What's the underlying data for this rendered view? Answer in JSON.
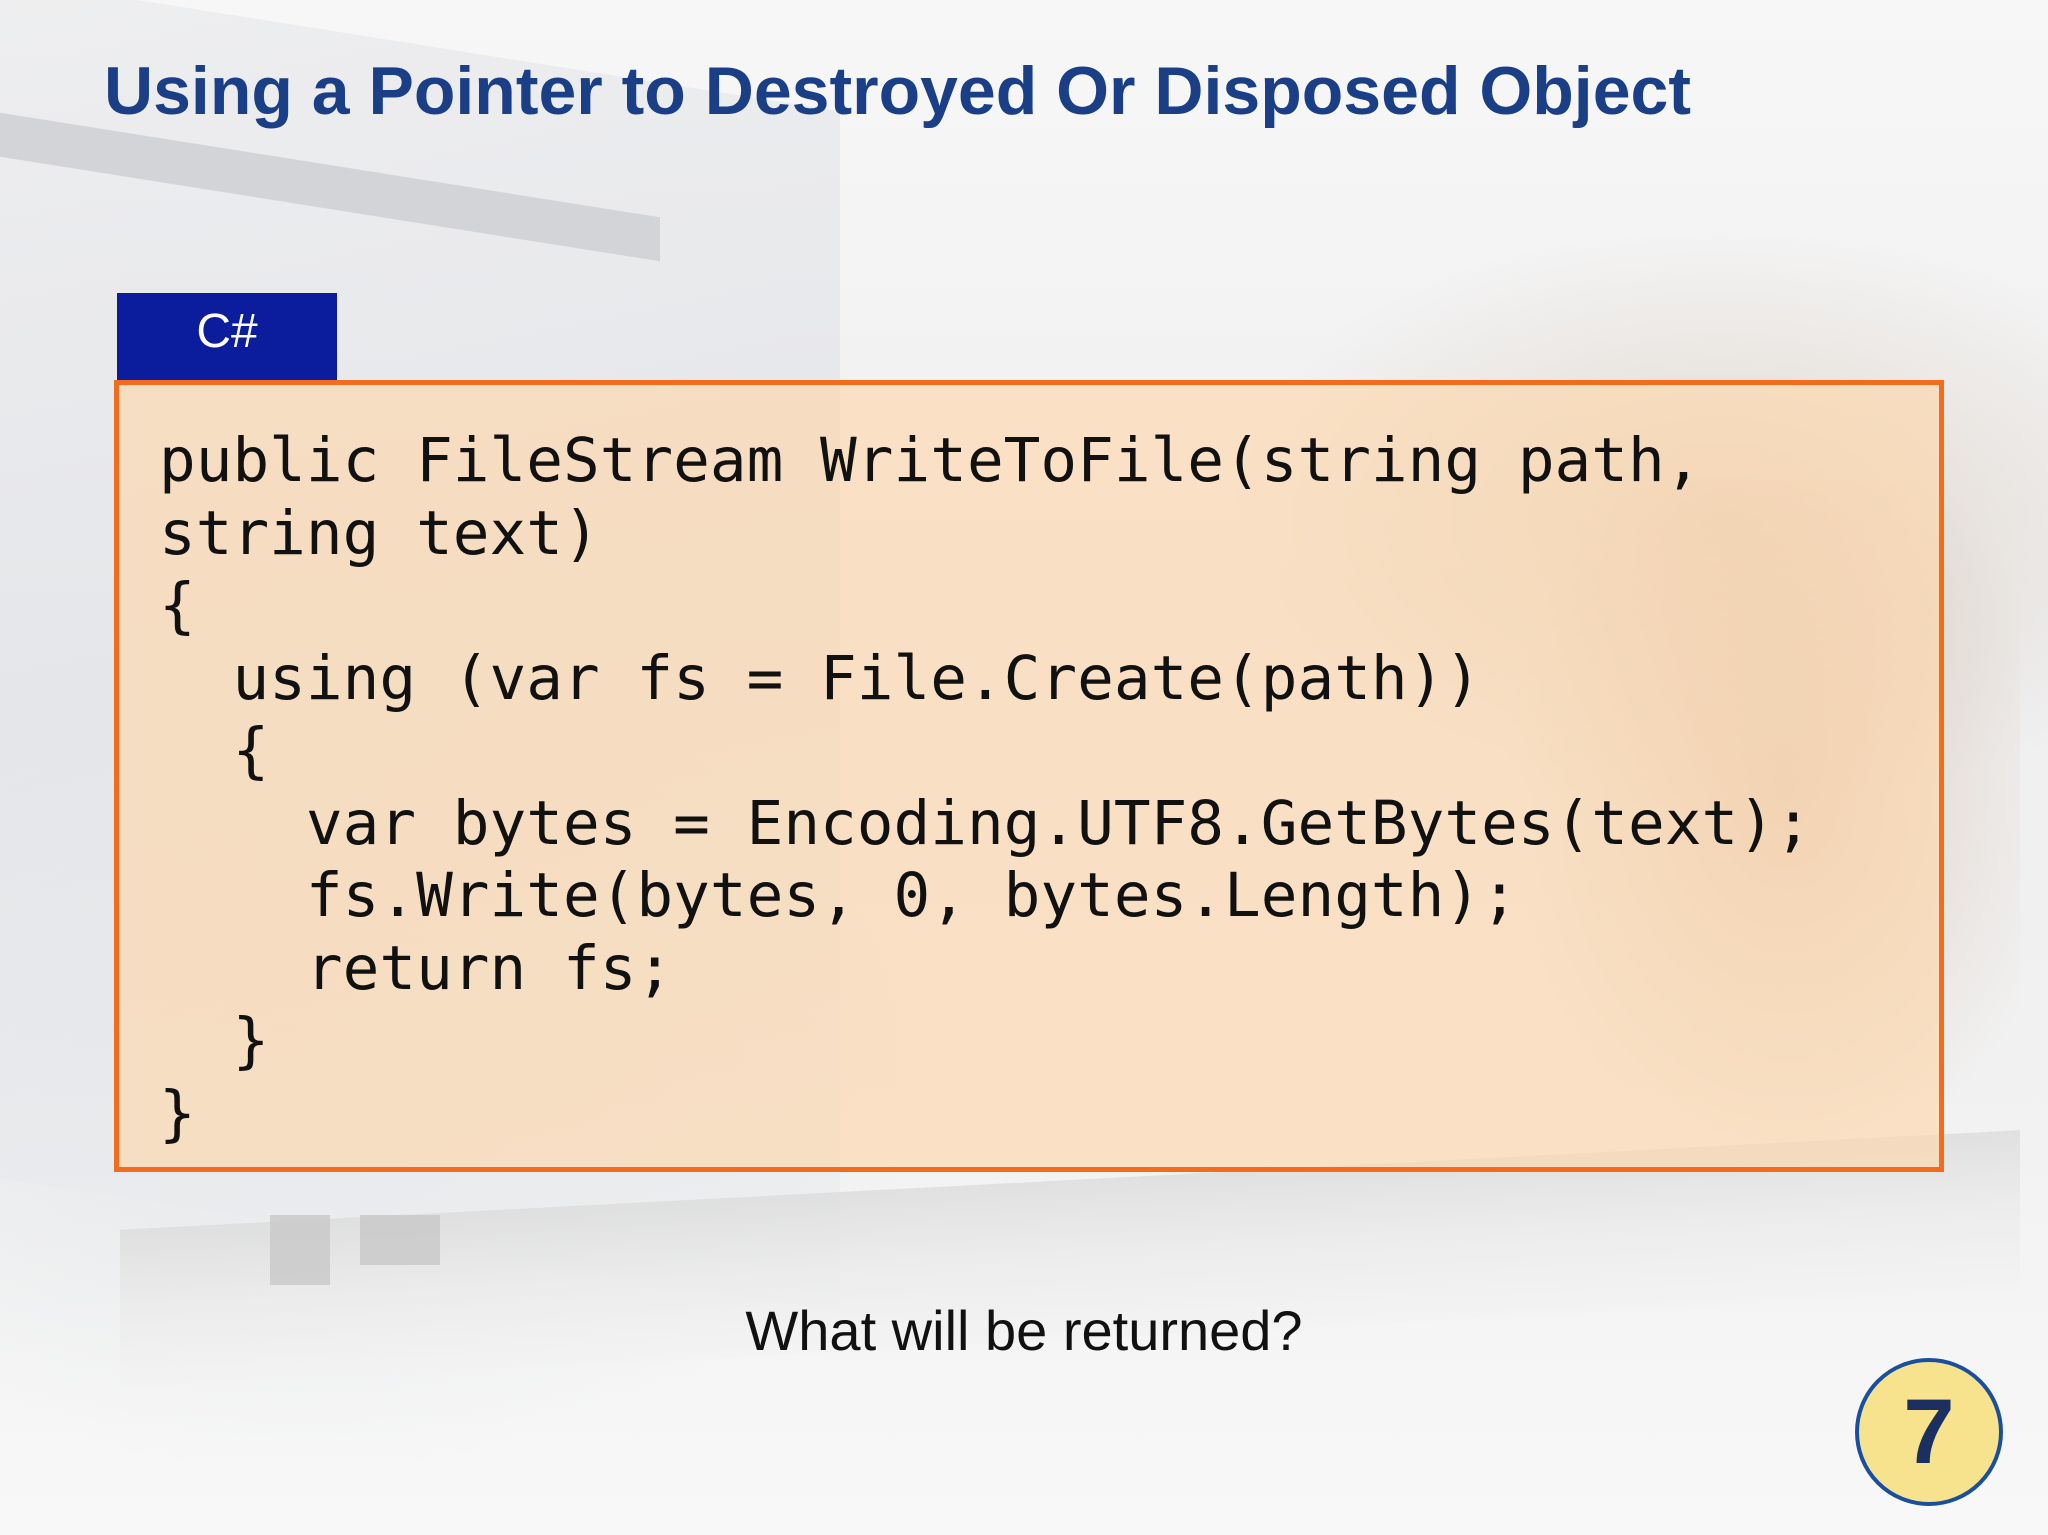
{
  "slide": {
    "title": "Using a Pointer  to Destroyed Or Disposed Object",
    "language_tab": "C#",
    "code_lines": [
      "public FileStream WriteToFile(string path,",
      "string text)",
      "{",
      "  using (var fs = File.Create(path))",
      "  {",
      "    var bytes = Encoding.UTF8.GetBytes(text);",
      "    fs.Write(bytes, 0, bytes.Length);",
      "    return fs;",
      "  }",
      "}"
    ],
    "question": "What will be returned?",
    "slide_number": "7"
  },
  "colors": {
    "title": "#1b3f86",
    "tab_background": "#0b1d9c",
    "code_border": "#f36b1c",
    "code_background": "#ffd6aa",
    "badge_fill": "#f7e28e",
    "badge_border": "#1a4fa0"
  }
}
